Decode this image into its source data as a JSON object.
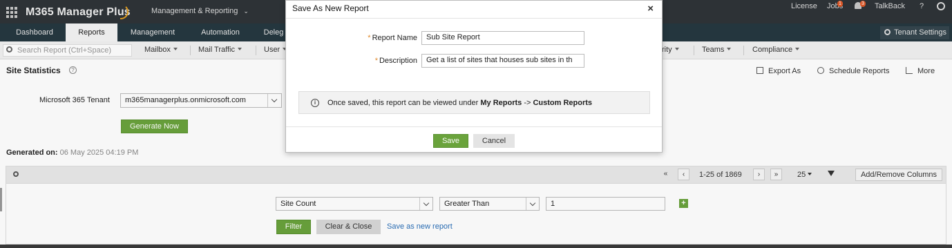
{
  "header": {
    "app_name": "M365 Manager Plus",
    "product_selector": "Management & Reporting",
    "license": "License",
    "jobs": "Jobs",
    "jobs_badge": "1",
    "alerts_badge": "3",
    "talkback": "TalkBack",
    "help": "?"
  },
  "tabs": [
    {
      "label": "Dashboard"
    },
    {
      "label": "Reports"
    },
    {
      "label": "Management"
    },
    {
      "label": "Automation"
    },
    {
      "label": "Deleg"
    }
  ],
  "tenant_settings": "Tenant Settings",
  "subnav": {
    "search_placeholder": "Search Report (Ctrl+Space)",
    "menus": [
      "Mailbox",
      "Mail Traffic",
      "User",
      "rity",
      "Teams",
      "Compliance"
    ]
  },
  "page": {
    "title": "Site Statistics",
    "help": "?",
    "actions": [
      "Export As",
      "Schedule Reports",
      "More"
    ],
    "tenant_label": "Microsoft 365 Tenant",
    "tenant_value": "m365managerplus.onmicrosoft.com",
    "generate_button": "Generate Now",
    "generated_label": "Generated on:",
    "generated_value": "06 May 2025 04:19 PM"
  },
  "grid": {
    "first": "«",
    "prev": "‹",
    "range": "1-25 of 1869",
    "next": "›",
    "last": "»",
    "page_size": "25",
    "add_remove": "Add/Remove Columns"
  },
  "filter": {
    "field": "Site Count",
    "operator": "Greater Than",
    "value": "1",
    "add": "+",
    "filter_button": "Filter",
    "clear_button": "Clear & Close",
    "save_link": "Save as new report"
  },
  "modal": {
    "title": "Save As New Report",
    "close": "×",
    "required_mark": "*",
    "name_label": "Report Name",
    "name_value": "Sub Site Report",
    "desc_label": "Description",
    "desc_value": "Get a list of sites that houses sub sites in th",
    "info_icon": "i",
    "info_prefix": "Once saved, this report can be viewed under",
    "info_my_reports": "My Reports",
    "info_arrow": "->",
    "info_custom_reports": "Custom Reports",
    "save_button": "Save",
    "cancel_button": "Cancel"
  },
  "colors": {
    "topbar": "#2f3438",
    "tabbar": "#263840",
    "accent_green": "#6aa33c",
    "link_blue": "#2a6fb8",
    "required_orange": "#e0892c"
  }
}
